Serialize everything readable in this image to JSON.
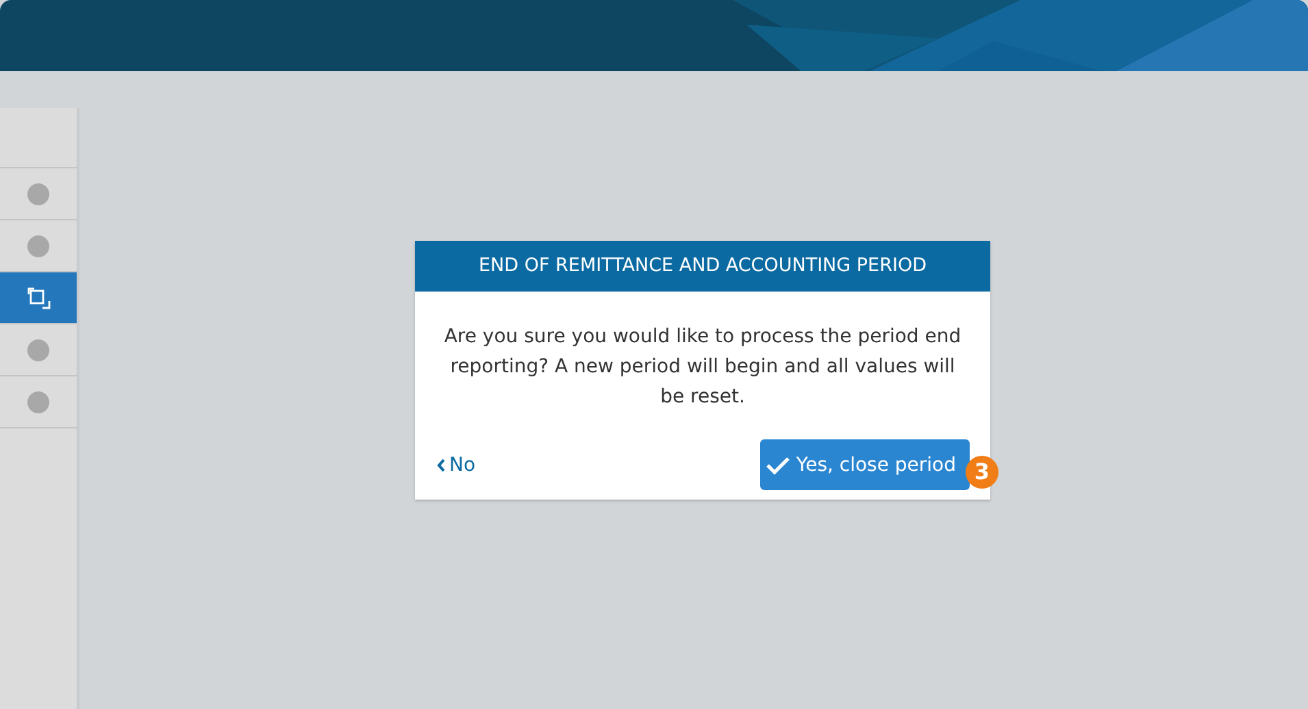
{
  "sidebar": {
    "items": [
      {
        "kind": "dot",
        "selected": false
      },
      {
        "kind": "dot",
        "selected": false
      },
      {
        "kind": "windows",
        "selected": true
      },
      {
        "kind": "dot",
        "selected": false
      },
      {
        "kind": "dot",
        "selected": false
      }
    ]
  },
  "dialog": {
    "title": "END OF REMITTANCE AND ACCOUNTING PERIOD",
    "message": "Are you sure you would like to process the period end reporting? A new period will begin and all values will be reset.",
    "cancel": "No",
    "confirm": "Yes, close period",
    "step_badge": "3"
  }
}
